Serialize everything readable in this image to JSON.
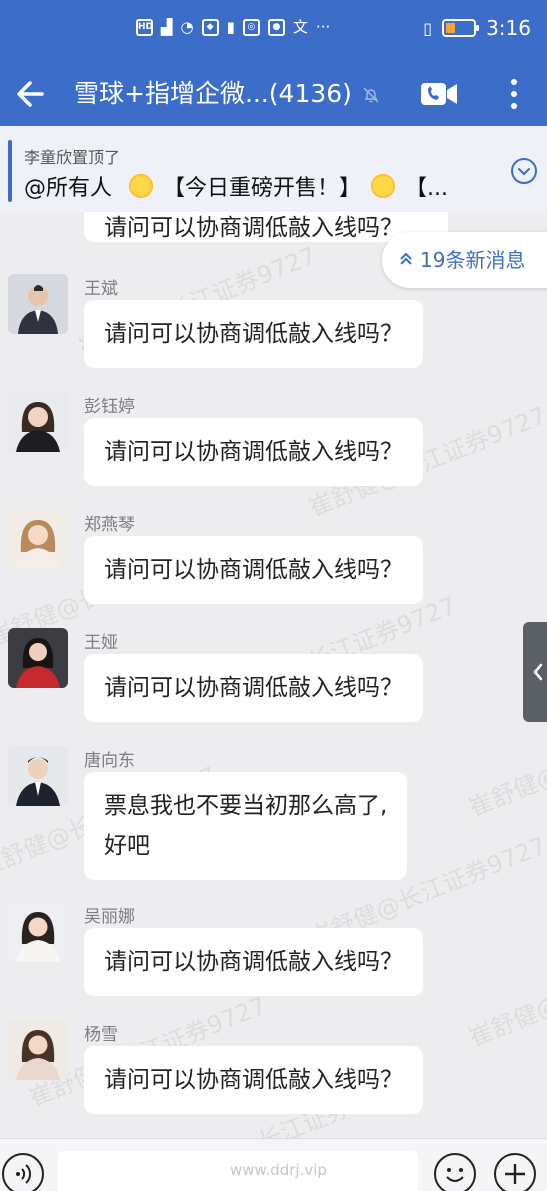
{
  "status_bar": {
    "left_icons": [
      "HD",
      "5G",
      "signal",
      "wifi",
      "shield-app",
      "alert",
      "sync-app",
      "bulb-app",
      "translate-app",
      "more"
    ],
    "time": "3:16"
  },
  "header": {
    "back_icon": "arrow-left-icon",
    "title": "雪球+指增企微...(4136)",
    "video_icon": "video-call-icon",
    "more_icon": "more-vertical-icon"
  },
  "pinned": {
    "who": "李童欣置顶了",
    "mention": "@所有人",
    "text": "【今日重磅开售！】",
    "tail": "【..."
  },
  "new_messages": {
    "label": "19条新消息"
  },
  "cut_message": {
    "text": "请问可以协商调低敲入线吗？"
  },
  "messages": [
    {
      "sender": "王斌",
      "text": "请问可以协商调低敲入线吗？"
    },
    {
      "sender": "彭钰婷",
      "text": "请问可以协商调低敲入线吗？"
    },
    {
      "sender": "郑燕琴",
      "text": "请问可以协商调低敲入线吗？"
    },
    {
      "sender": "王娅",
      "text": "请问可以协商调低敲入线吗？"
    },
    {
      "sender": "唐向东",
      "text_line1": "票息我也不要当初那么高了,",
      "text_line2": "好吧"
    },
    {
      "sender": "吴丽娜",
      "text": "请问可以协商调低敲入线吗？"
    },
    {
      "sender": "杨雪",
      "text": "请问可以协商调低敲入线吗？"
    }
  ],
  "watermarks": [
    "崔舒健@长江证券9727"
  ],
  "input": {
    "domain": "www.ddrj.vip"
  },
  "colors": {
    "brand_blue": "#3c6ec9",
    "chat_bg": "#ededef",
    "bubble_bg": "#ffffff"
  }
}
